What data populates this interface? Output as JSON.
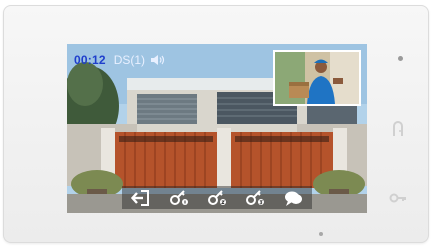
{
  "status": {
    "timer": "00:12",
    "source": "DS(1)",
    "speaker_icon": "speaker-icon"
  },
  "colors": {
    "timer": "#1f3fcc",
    "toolbar_bg": "rgba(35,35,35,0.45)",
    "gate": "#b5532b"
  },
  "toolbar": {
    "buttons": [
      {
        "icon": "exit-icon"
      },
      {
        "icon": "unlock-1-icon"
      },
      {
        "icon": "unlock-2-icon"
      },
      {
        "icon": "unlock-3-icon"
      },
      {
        "icon": "chat-icon"
      }
    ]
  },
  "side_buttons": [
    {
      "icon": "door-icon"
    },
    {
      "icon": "key-icon"
    }
  ]
}
